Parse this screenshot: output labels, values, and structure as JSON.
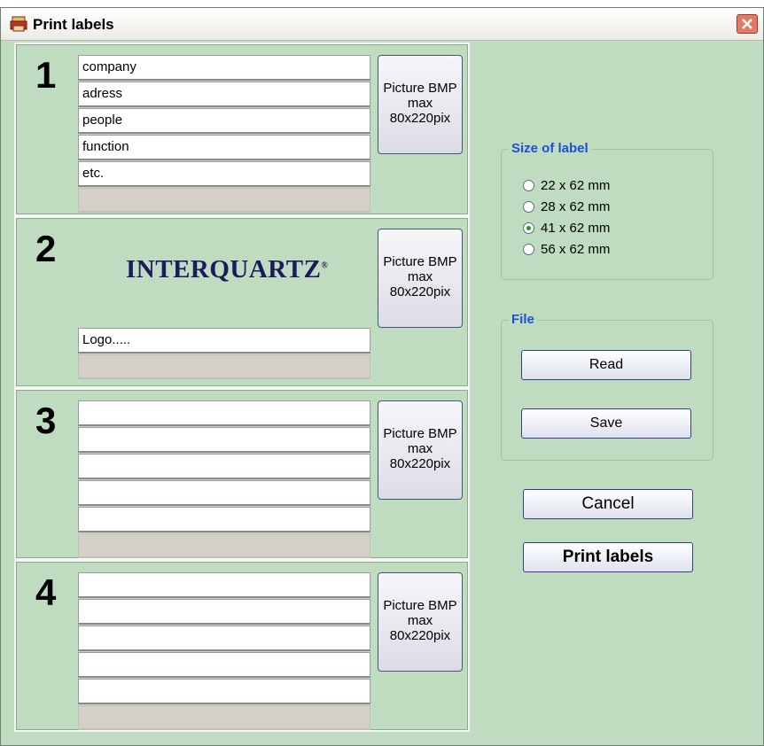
{
  "window": {
    "title": "Print labels"
  },
  "panels": [
    {
      "number": "1",
      "lines": [
        "company",
        "adress",
        "people",
        "function",
        "etc."
      ],
      "picture_button": [
        "Picture BMP",
        "max",
        "80x220pix"
      ]
    },
    {
      "number": "2",
      "logo": "INTERQUARTZ",
      "logo_mark": "®",
      "lines": [
        "Logo....."
      ],
      "picture_button": [
        "Picture BMP",
        "max",
        "80x220pix"
      ]
    },
    {
      "number": "3",
      "lines": [
        "",
        "",
        "",
        "",
        ""
      ],
      "picture_button": [
        "Picture BMP",
        "max",
        "80x220pix"
      ]
    },
    {
      "number": "4",
      "lines": [
        "",
        "",
        "",
        "",
        ""
      ],
      "picture_button": [
        "Picture BMP",
        "max",
        "80x220pix"
      ]
    }
  ],
  "size_group": {
    "title": "Size of label",
    "options": [
      "22 x 62 mm",
      "28 x 62 mm",
      "41 x 62 mm",
      "56 x 62 mm"
    ],
    "selected": "41 x 62 mm"
  },
  "file_group": {
    "title": "File",
    "read_label": "Read",
    "save_label": "Save"
  },
  "actions": {
    "cancel_label": "Cancel",
    "print_label": "Print labels"
  },
  "colors": {
    "background": "#c0dcc0",
    "group_title": "#1a4fd8",
    "close_button": "#e27a67"
  }
}
